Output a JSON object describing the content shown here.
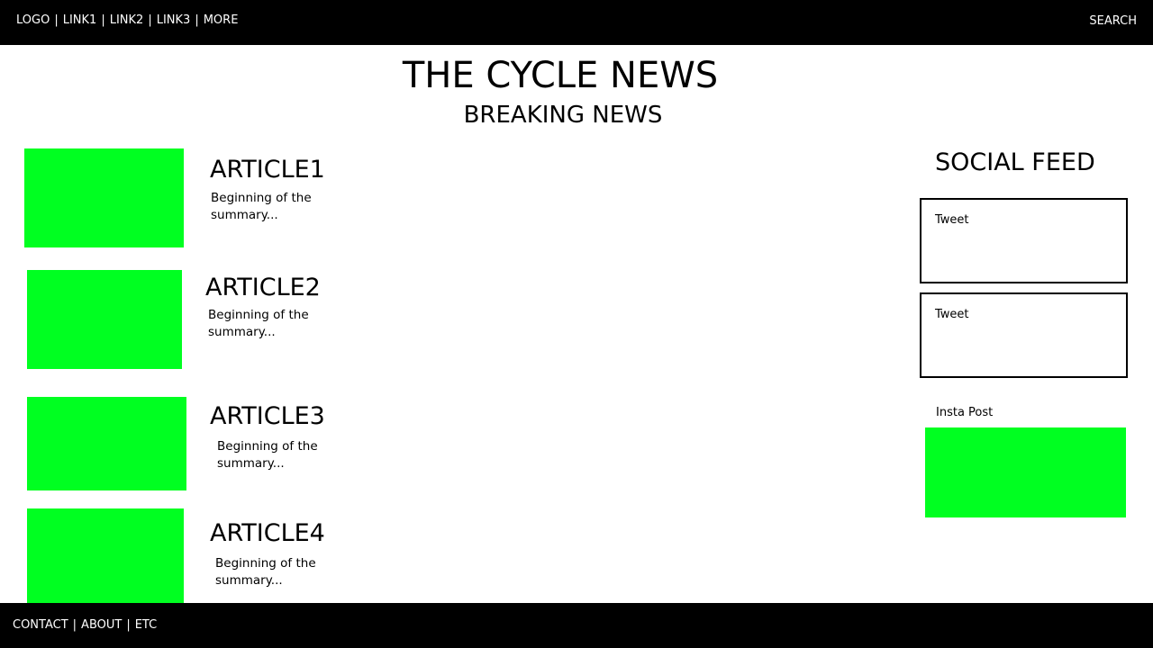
{
  "topnav": {
    "logo": "LOGO",
    "separator": "|",
    "links": [
      "LINK1",
      "LINK2",
      "LINK3",
      "MORE"
    ],
    "search_label": "SEARCH"
  },
  "header": {
    "site_title": "THE CYCLE NEWS",
    "section_title": "BREAKING NEWS"
  },
  "articles": [
    {
      "title": "ARTICLE1",
      "summary": "Beginning of the summary..."
    },
    {
      "title": "ARTICLE2",
      "summary": "Beginning of the summary..."
    },
    {
      "title": "ARTICLE3",
      "summary": "Beginning of the summary..."
    },
    {
      "title": "ARTICLE4",
      "summary": "Beginning of the summary..."
    }
  ],
  "social": {
    "title": "SOCIAL FEED",
    "tweets": [
      {
        "label": "Tweet"
      },
      {
        "label": "Tweet"
      }
    ],
    "insta_label": "Insta Post"
  },
  "footer": {
    "links": [
      "CONTACT",
      "ABOUT",
      "ETC"
    ],
    "separator": "|"
  },
  "colors": {
    "bar_background": "#000000",
    "bar_text": "#ffffff",
    "placeholder_green": "#00ff21",
    "page_background": "#ffffff"
  }
}
